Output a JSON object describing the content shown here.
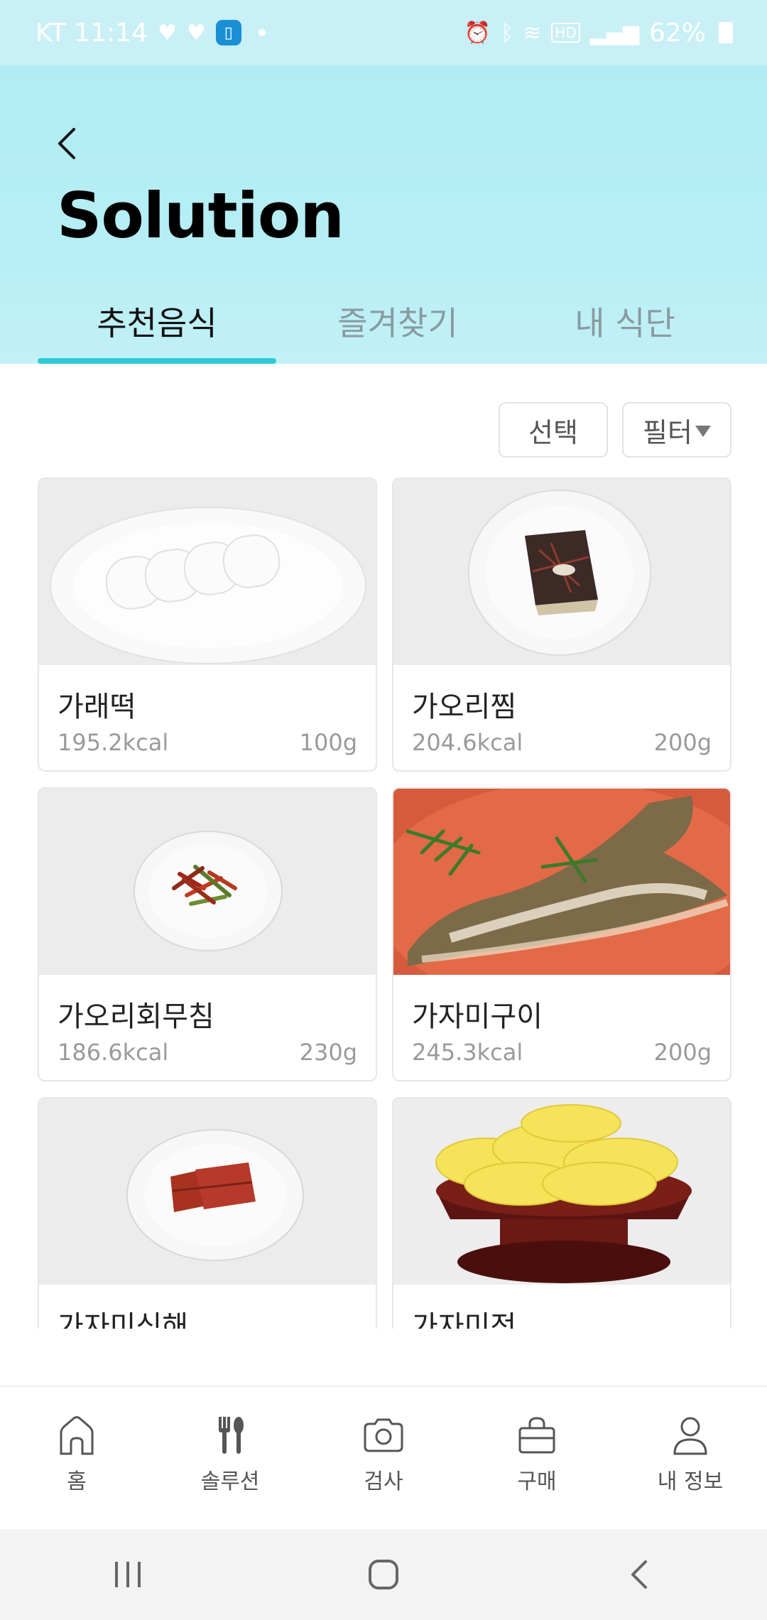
{
  "status_bar": {
    "carrier_time": "KT 11:14",
    "battery": "62%",
    "left_icons": [
      "heart-wave-icon",
      "heart-wave-icon",
      "app-square-icon",
      "dot-icon"
    ],
    "right_icons": [
      "alarm-icon",
      "bluetooth-icon",
      "wifi-icon",
      "hd-icon",
      "signal-icon",
      "battery-icon"
    ]
  },
  "header": {
    "title": "Solution",
    "back_icon": "chevron-left-icon",
    "background": "#b6eef5"
  },
  "tabs": [
    {
      "label": "추천음식",
      "active": true
    },
    {
      "label": "즐겨찾기",
      "active": false
    },
    {
      "label": "내 식단",
      "active": false
    }
  ],
  "accent_color": "#2fcbd6",
  "actions": {
    "select_label": "선택",
    "filter_label": "필터"
  },
  "foods": [
    {
      "name": "가래떡",
      "kcal": "195.2kcal",
      "weight": "100g",
      "image": "rice-cake-photo"
    },
    {
      "name": "가오리찜",
      "kcal": "204.6kcal",
      "weight": "200g",
      "image": "steamed-stingray-photo"
    },
    {
      "name": "가오리회무침",
      "kcal": "186.6kcal",
      "weight": "230g",
      "image": "stingray-salad-photo"
    },
    {
      "name": "가자미구이",
      "kcal": "245.3kcal",
      "weight": "200g",
      "image": "grilled-flounder-photo"
    },
    {
      "name": "가자미식해",
      "kcal": "",
      "weight": "",
      "image": "fermented-flounder-photo"
    },
    {
      "name": "가자미전",
      "kcal": "",
      "weight": "",
      "image": "flounder-pancake-photo"
    }
  ],
  "bottom_nav": [
    {
      "label": "홈",
      "icon": "home-icon"
    },
    {
      "label": "솔루션",
      "icon": "fork-knife-icon"
    },
    {
      "label": "검사",
      "icon": "camera-icon"
    },
    {
      "label": "구매",
      "icon": "shopping-bag-icon"
    },
    {
      "label": "내 정보",
      "icon": "person-icon"
    }
  ],
  "system_nav": [
    "recent-apps-icon",
    "home-button-icon",
    "back-icon"
  ]
}
